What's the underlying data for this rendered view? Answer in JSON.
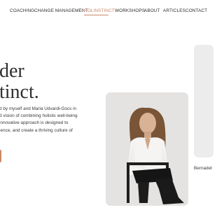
{
  "nav": {
    "items": [
      "COACHING",
      "CHANGE MANAGEMENT",
      "HOLINSTINCT",
      "WORKSHOPS",
      "ABOUT",
      "ARTICLES",
      "CONTACT"
    ],
    "active": "HOLINSTINCT",
    "accent_color": "#c9896a"
  },
  "hero": {
    "heading_line1": "der",
    "heading_line2": "tinct.",
    "body": "d by myself and Maria Udvardi-Gocs in\nd vision of combining holistic well-being\ninnovative approach is designed to\nience, and create a thriving culture of"
  },
  "photo": {
    "icon": "portrait-photo"
  },
  "side_card": {
    "name": "Bernadet"
  }
}
